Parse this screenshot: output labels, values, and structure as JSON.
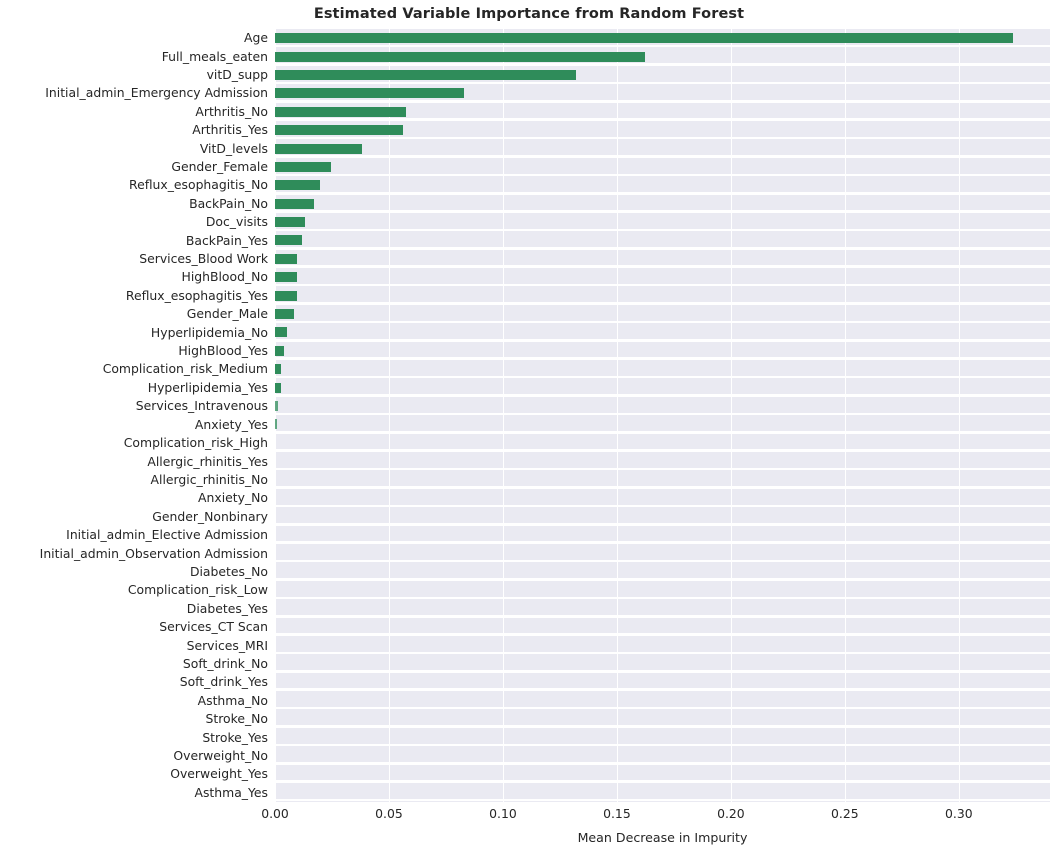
{
  "chart_data": {
    "type": "bar",
    "orientation": "horizontal",
    "title": "Estimated Variable Importance from Random Forest",
    "xlabel": "Mean Decrease in Impurity",
    "ylabel": "",
    "xlim": [
      0.0,
      0.34
    ],
    "xticks": [
      0.0,
      0.05,
      0.1,
      0.15,
      0.2,
      0.25,
      0.3
    ],
    "xtick_labels": [
      "0.00",
      "0.05",
      "0.10",
      "0.15",
      "0.20",
      "0.25",
      "0.30"
    ],
    "grid": "vertical-white-on-lavender",
    "legend": "none",
    "bar_color": "#2f8c5a",
    "plot_background": "#eaeaf2",
    "figure_background": "#ffffff",
    "categories": [
      "Age",
      "Full_meals_eaten",
      "vitD_supp",
      "Initial_admin_Emergency Admission",
      "Arthritis_No",
      "Arthritis_Yes",
      "VitD_levels",
      "Gender_Female",
      "Reflux_esophagitis_No",
      "BackPain_No",
      "Doc_visits",
      "BackPain_Yes",
      "Services_Blood Work",
      "HighBlood_No",
      "Reflux_esophagitis_Yes",
      "Gender_Male",
      "Hyperlipidemia_No",
      "HighBlood_Yes",
      "Complication_risk_Medium",
      "Hyperlipidemia_Yes",
      "Services_Intravenous",
      "Anxiety_Yes",
      "Complication_risk_High",
      "Allergic_rhinitis_Yes",
      "Allergic_rhinitis_No",
      "Anxiety_No",
      "Gender_Nonbinary",
      "Initial_admin_Elective Admission",
      "Initial_admin_Observation Admission",
      "Diabetes_No",
      "Complication_risk_Low",
      "Diabetes_Yes",
      "Services_CT Scan",
      "Services_MRI",
      "Soft_drink_No",
      "Soft_drink_Yes",
      "Asthma_No",
      "Stroke_No",
      "Stroke_Yes",
      "Overweight_No",
      "Overweight_Yes",
      "Asthma_Yes"
    ],
    "values": [
      0.3237,
      0.1623,
      0.132,
      0.0829,
      0.0574,
      0.056,
      0.0382,
      0.0246,
      0.0197,
      0.0171,
      0.0133,
      0.0118,
      0.0096,
      0.0096,
      0.0096,
      0.0082,
      0.0053,
      0.0041,
      0.0025,
      0.0025,
      0.0012,
      0.0007,
      0.0,
      0.0,
      0.0,
      0.0,
      0.0,
      0.0,
      0.0,
      0.0,
      0.0,
      0.0,
      0.0,
      0.0,
      0.0,
      0.0,
      0.0,
      0.0,
      0.0,
      0.0,
      0.0,
      0.0
    ]
  }
}
